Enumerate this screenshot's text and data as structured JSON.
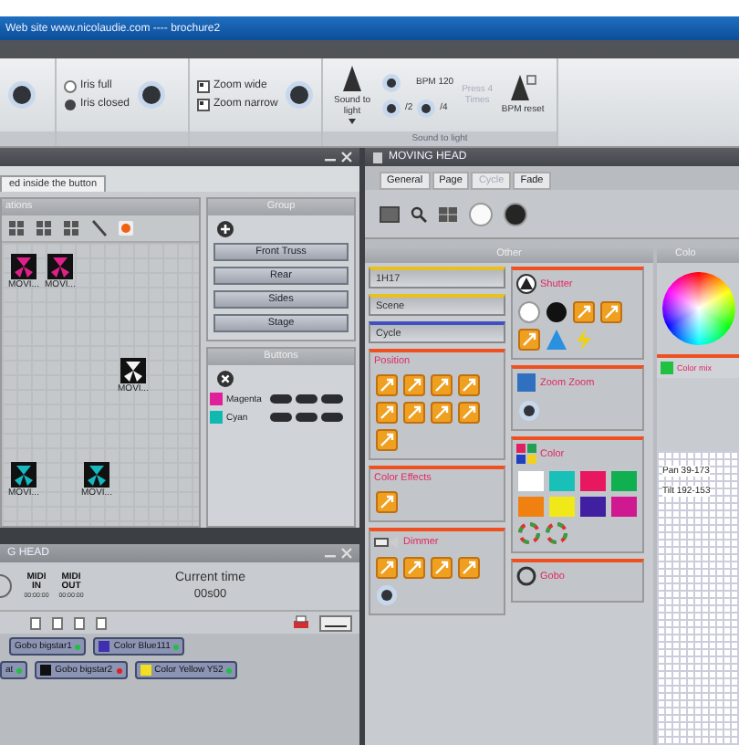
{
  "window": {
    "title": "Web site www.nicolaudie.com ---- brochure2"
  },
  "ribbon": {
    "iris_options": [
      "Iris full",
      "Iris closed"
    ],
    "zoom_options": [
      "Zoom wide",
      "Zoom narrow"
    ],
    "sound_to_light": {
      "mode_button": "Sound to light",
      "bpm": "BPM 120",
      "half": "/2",
      "quarter": "/4",
      "tap_button": {
        "label": "Press 4 Times",
        "disabled": true
      },
      "reset_button": "BPM reset",
      "group_label": "Sound to light"
    }
  },
  "fixture_panel": {
    "tab": "ed inside the button",
    "section_title": "ations",
    "fixtures": [
      {
        "label": "MOVI...",
        "color": "#e0208a"
      },
      {
        "label": "MOVI...",
        "color": "#e0208a"
      },
      {
        "label": "MOVI...",
        "color": "#f4f4f4"
      },
      {
        "label": "MOVI...",
        "color": "#18b8c0"
      },
      {
        "label": "MOVI...",
        "color": "#18b8c0"
      }
    ],
    "group": {
      "title": "Group",
      "buttons": [
        "Front Truss",
        "Rear",
        "Sides",
        "Stage"
      ]
    },
    "buttons": {
      "title": "Buttons",
      "rows": [
        {
          "label": "Magenta",
          "color": "#e0209a"
        },
        {
          "label": "Cyan",
          "color": "#10b8b0"
        }
      ]
    }
  },
  "timeline_panel": {
    "title": "G HEAD",
    "midi": [
      {
        "label": "MIDI IN",
        "time": "00:00:00"
      },
      {
        "label": "MIDI OUT",
        "time": "00:00:00"
      }
    ],
    "current_time_label": "Current time",
    "current_time": "00s00",
    "clip_rows": [
      [
        {
          "label": "Gobo bigstar1",
          "active": true
        },
        {
          "label": "Color Blue111",
          "color": "#4030b0",
          "active": true
        }
      ],
      [
        {
          "label": "at",
          "active": true
        },
        {
          "label": "Gobo bigstar2",
          "color": "#101010",
          "active": false
        },
        {
          "label": "Color Yellow Y52",
          "color": "#f0e020",
          "active": true
        }
      ]
    ]
  },
  "moving_head": {
    "title": "MOVING HEAD",
    "tabs": [
      {
        "label": "General",
        "disabled": false
      },
      {
        "label": "Page",
        "disabled": false
      },
      {
        "label": "Cycle",
        "disabled": true
      },
      {
        "label": "Fade",
        "disabled": false
      }
    ],
    "other_title": "Other",
    "presets": [
      {
        "label": "1H17",
        "color": "#e8c020"
      },
      {
        "label": "Scene",
        "color": "#e8c020"
      },
      {
        "label": "Cycle",
        "color": "#4050c0"
      }
    ],
    "left_sections": [
      {
        "kind": "position",
        "title": "Position"
      },
      {
        "kind": "effects",
        "title": "Color Effects"
      },
      {
        "kind": "dimmer",
        "title": "Dimmer"
      }
    ],
    "mid_sections": [
      {
        "kind": "shutter",
        "title": "Shutter"
      },
      {
        "kind": "knob",
        "title": "Zoom Zoom"
      },
      {
        "kind": "colors",
        "title": "Color",
        "swatches": [
          {
            "color": "#ffffff"
          },
          {
            "color": "#18c0b8"
          },
          {
            "color": "#e81860"
          },
          {
            "color": "#10b050"
          },
          {
            "color": "#f08010"
          },
          {
            "color": "#f0e818"
          },
          {
            "color": "#4020a0"
          },
          {
            "color": "#d01890"
          }
        ]
      },
      {
        "kind": "gobo",
        "title": "Gobo"
      }
    ],
    "color_column": {
      "title": "Colo",
      "mix_item": "Color mix",
      "pan": "Pan 39-173",
      "tilt": "Tilt 192-153"
    }
  }
}
